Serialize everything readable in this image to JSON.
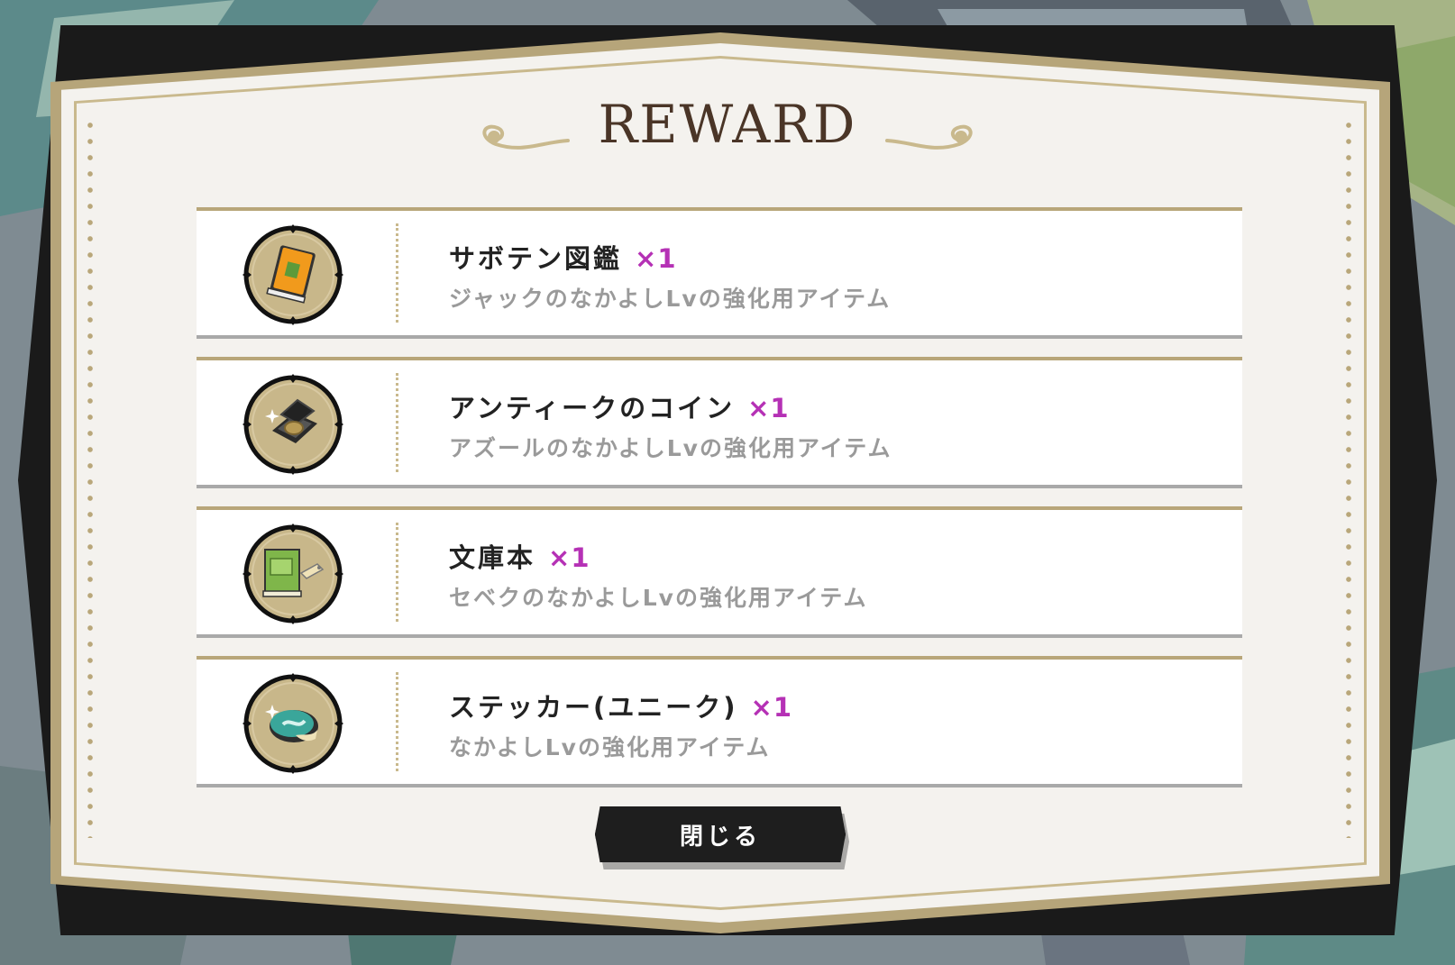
{
  "dialog": {
    "title": "REWARD",
    "close_label": "閉じる"
  },
  "rewards": [
    {
      "name": "サボテン図鑑",
      "qty": "×1",
      "desc": "ジャックのなかよしLvの強化用アイテム",
      "icon": "cactus-book-icon"
    },
    {
      "name": "アンティークのコイン",
      "qty": "×1",
      "desc": "アズールのなかよしLvの強化用アイテム",
      "icon": "antique-coin-icon"
    },
    {
      "name": "文庫本",
      "qty": "×1",
      "desc": "セベクのなかよしLvの強化用アイテム",
      "icon": "paperback-book-icon"
    },
    {
      "name": "ステッカー(ユニーク)",
      "qty": "×1",
      "desc": "なかよしLvの強化用アイテム",
      "icon": "sticker-icon"
    }
  ],
  "colors": {
    "frame_gold": "#b6a57a",
    "panel": "#f4f2ee",
    "qty_purple": "#b531b5",
    "button_dark": "#1e1e1e"
  }
}
